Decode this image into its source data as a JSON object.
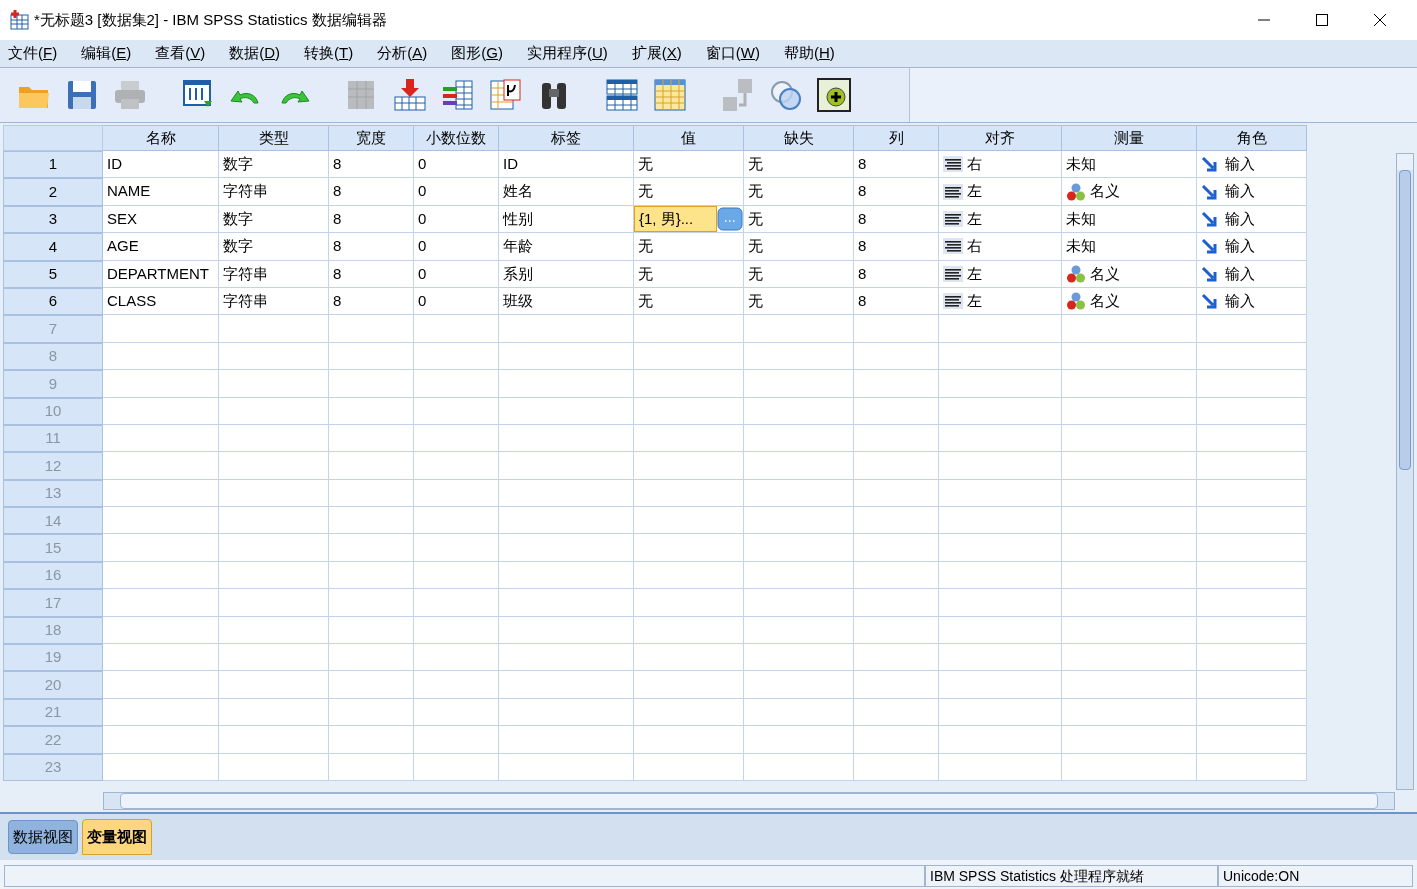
{
  "window": {
    "title": "*无标题3 [数据集2] - IBM SPSS Statistics 数据编辑器"
  },
  "menu": [
    "文件(F)",
    "编辑(E)",
    "查看(V)",
    "数据(D)",
    "转换(T)",
    "分析(A)",
    "图形(G)",
    "实用程序(U)",
    "扩展(X)",
    "窗口(W)",
    "帮助(H)"
  ],
  "toolbar": [
    {
      "kind": "open",
      "disabled": false
    },
    {
      "kind": "save",
      "disabled": false
    },
    {
      "kind": "print",
      "disabled": true
    },
    {
      "kind": "sep"
    },
    {
      "kind": "recall",
      "disabled": false
    },
    {
      "kind": "undo",
      "disabled": false
    },
    {
      "kind": "redo",
      "disabled": false
    },
    {
      "kind": "sep"
    },
    {
      "kind": "goto",
      "disabled": true
    },
    {
      "kind": "insertcase",
      "disabled": false
    },
    {
      "kind": "insertvar",
      "disabled": false
    },
    {
      "kind": "varinfo",
      "disabled": false
    },
    {
      "kind": "find",
      "disabled": false
    },
    {
      "kind": "sep"
    },
    {
      "kind": "split",
      "disabled": false
    },
    {
      "kind": "select",
      "disabled": false
    },
    {
      "kind": "sep"
    },
    {
      "kind": "labels",
      "disabled": true
    },
    {
      "kind": "sets",
      "disabled": false
    },
    {
      "kind": "addon",
      "disabled": false
    }
  ],
  "table": {
    "columns": [
      "名称",
      "类型",
      "宽度",
      "小数位数",
      "标签",
      "值",
      "缺失",
      "列",
      "对齐",
      "测量",
      "角色"
    ],
    "rows": [
      {
        "number": "1",
        "cells": [
          "ID",
          "数字",
          "8",
          "0",
          "ID",
          "无",
          "无",
          "8"
        ],
        "align": {
          "kind": "right",
          "text": "右"
        },
        "measure": {
          "kind": "unknown",
          "text": "未知"
        },
        "role": "输入",
        "selected_value": false
      },
      {
        "number": "2",
        "cells": [
          "NAME",
          "字符串",
          "8",
          "0",
          "姓名",
          "无",
          "无",
          "8"
        ],
        "align": {
          "kind": "left",
          "text": "左"
        },
        "measure": {
          "kind": "nominal",
          "text": "名义"
        },
        "role": "输入",
        "selected_value": false
      },
      {
        "number": "3",
        "cells": [
          "SEX",
          "数字",
          "8",
          "0",
          "性别",
          "{1, 男}...",
          "无",
          "8"
        ],
        "align": {
          "kind": "left",
          "text": "左"
        },
        "measure": {
          "kind": "unknown",
          "text": "未知"
        },
        "role": "输入",
        "selected_value": true
      },
      {
        "number": "4",
        "cells": [
          "AGE",
          "数字",
          "8",
          "0",
          "年龄",
          "无",
          "无",
          "8"
        ],
        "align": {
          "kind": "right",
          "text": "右"
        },
        "measure": {
          "kind": "unknown",
          "text": "未知"
        },
        "role": "输入",
        "selected_value": false
      },
      {
        "number": "5",
        "cells": [
          "DEPARTMENT",
          "字符串",
          "8",
          "0",
          "系别",
          "无",
          "无",
          "8"
        ],
        "align": {
          "kind": "left",
          "text": "左"
        },
        "measure": {
          "kind": "nominal",
          "text": "名义"
        },
        "role": "输入",
        "selected_value": false
      },
      {
        "number": "6",
        "cells": [
          "CLASS",
          "字符串",
          "8",
          "0",
          "班级",
          "无",
          "无",
          "8"
        ],
        "align": {
          "kind": "left",
          "text": "左"
        },
        "measure": {
          "kind": "nominal",
          "text": "名义"
        },
        "role": "输入",
        "selected_value": false
      }
    ],
    "empty_rows": [
      "7",
      "8",
      "9",
      "10",
      "11",
      "12",
      "13",
      "14",
      "15",
      "16",
      "17",
      "18",
      "19",
      "20",
      "21",
      "22",
      "23"
    ]
  },
  "view_tabs": [
    {
      "label": "数据视图",
      "selected": false
    },
    {
      "label": "变量视图",
      "selected": true
    }
  ],
  "status_bar": {
    "processor": "IBM SPSS Statistics 处理程序就绪",
    "unicode": "Unicode:ON"
  }
}
